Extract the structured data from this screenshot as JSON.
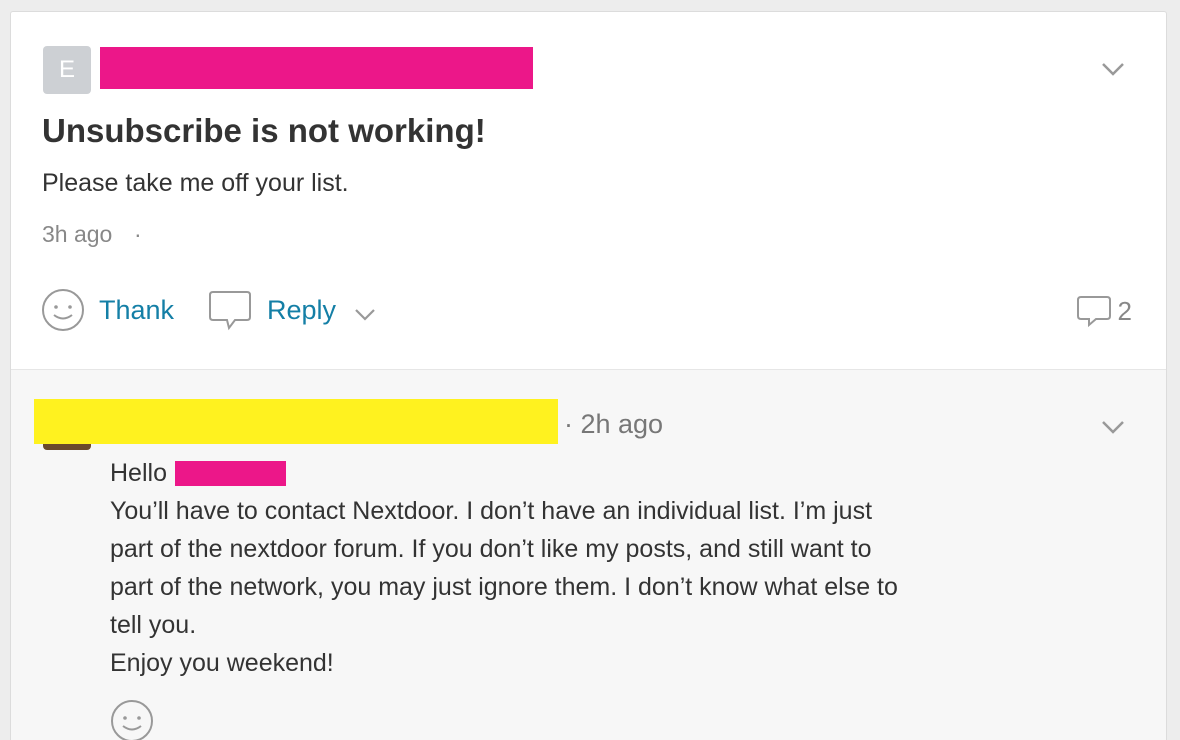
{
  "post": {
    "author_initial": "E",
    "title": "Unsubscribe is not working!",
    "body": "Please take me off your list.",
    "time": "3h ago",
    "separator": "·"
  },
  "actions": {
    "thank_label": "Thank",
    "reply_label": "Reply",
    "comment_count": "2"
  },
  "reply": {
    "time": "· 2h ago",
    "hello": "Hello",
    "lines": [
      "You’ll have to contact Nextdoor. I don’t have an individual list. I’m just",
      "part of the nextdoor forum. If you don’t like my posts, and still want to",
      "part of the network, you may just ignore them. I don’t know what else to",
      "tell you.",
      "Enjoy you weekend!"
    ]
  },
  "colors": {
    "link": "#147fa6",
    "redact_pink": "#ec1789",
    "redact_yellow": "#fff21f"
  },
  "icons": [
    "chevron-down-icon",
    "smiley-icon",
    "speech-bubble-icon",
    "comment-icon"
  ]
}
